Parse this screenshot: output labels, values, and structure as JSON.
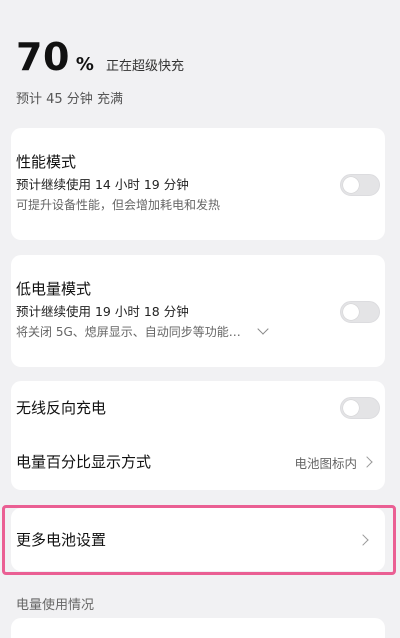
{
  "battery": {
    "percent": "70",
    "percent_sign": "%",
    "charge_status": "正在超级快充",
    "full_estimate": "预计 45 分钟 充满"
  },
  "performance_mode": {
    "title": "性能模式",
    "estimate": "预计继续使用 14 小时 19 分钟",
    "description": "可提升设备性能，但会增加耗电和发热",
    "enabled": false
  },
  "low_power_mode": {
    "title": "低电量模式",
    "estimate": "预计继续使用 19 小时 18 分钟",
    "description": "将关闭 5G、熄屏显示、自动同步等功能…",
    "enabled": false
  },
  "wireless_reverse_charging": {
    "title": "无线反向充电",
    "enabled": false
  },
  "percentage_display": {
    "title": "电量百分比显示方式",
    "value": "电池图标内"
  },
  "more_battery_settings": {
    "title": "更多电池设置"
  },
  "usage_section": {
    "label": "电量使用情况"
  },
  "colors": {
    "highlight": "#ea5f93",
    "toggle_off": "#e4e4e6",
    "background": "#f1f1f3",
    "card": "#ffffff"
  }
}
